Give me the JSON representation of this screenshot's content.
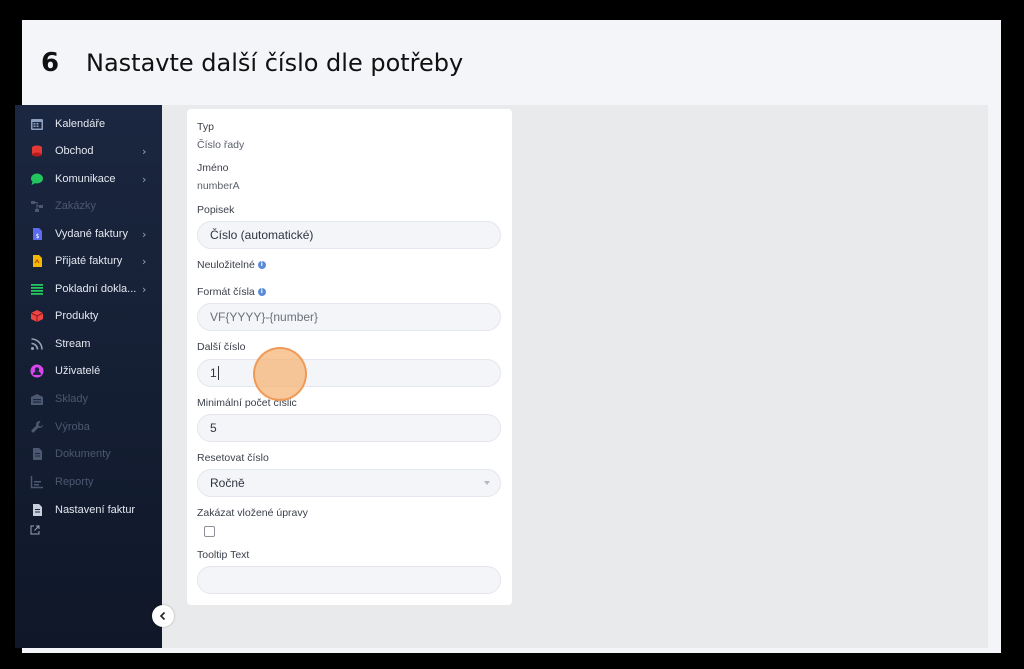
{
  "step": {
    "number": "6",
    "title": "Nastavte další číslo dle potřeby"
  },
  "sidebar": {
    "items": [
      {
        "label": "Kalendáře",
        "icon": "calendar-icon",
        "color": "#8ea0c0",
        "chevron": false,
        "dim": false
      },
      {
        "label": "Obchod",
        "icon": "coins-icon",
        "color": "#e53935",
        "chevron": true,
        "dim": false
      },
      {
        "label": "Komunikace",
        "icon": "chat-icon",
        "color": "#22c55e",
        "chevron": true,
        "dim": false
      },
      {
        "label": "Zakázky",
        "icon": "flow-icon",
        "color": "#4c5770",
        "chevron": false,
        "dim": true
      },
      {
        "label": "Vydané faktury",
        "icon": "invoice-out-icon",
        "color": "#5b6cf0",
        "chevron": true,
        "dim": false
      },
      {
        "label": "Přijaté faktury",
        "icon": "invoice-in-icon",
        "color": "#f5b800",
        "chevron": true,
        "dim": false
      },
      {
        "label": "Pokladní dokla...",
        "icon": "list-icon",
        "color": "#22c55e",
        "chevron": true,
        "dim": false
      },
      {
        "label": "Produkty",
        "icon": "box-icon",
        "color": "#ef4444",
        "chevron": false,
        "dim": false
      },
      {
        "label": "Stream",
        "icon": "rss-icon",
        "color": "#9aa3b5",
        "chevron": false,
        "dim": false
      },
      {
        "label": "Uživatelé",
        "icon": "user-icon",
        "color": "#d946ef",
        "chevron": false,
        "dim": false
      },
      {
        "label": "Sklady",
        "icon": "warehouse-icon",
        "color": "#4c5770",
        "chevron": false,
        "dim": true
      },
      {
        "label": "Výroba",
        "icon": "wrench-icon",
        "color": "#4c5770",
        "chevron": false,
        "dim": true
      },
      {
        "label": "Dokumenty",
        "icon": "document-icon",
        "color": "#4c5770",
        "chevron": false,
        "dim": true
      },
      {
        "label": "Reporty",
        "icon": "report-icon",
        "color": "#4c5770",
        "chevron": false,
        "dim": true
      },
      {
        "label": "Nastavení faktur",
        "icon": "settings-doc-icon",
        "color": "#c9d0dd",
        "chevron": false,
        "dim": false
      }
    ]
  },
  "form": {
    "typ_label": "Typ",
    "typ_value": "Číslo řady",
    "jmeno_label": "Jméno",
    "jmeno_value": "numberA",
    "popisek_label": "Popisek",
    "popisek_value": "Číslo (automatické)",
    "neulozitelne_label": "Neuložitelné",
    "format_label": "Formát čísla",
    "format_value": "VF{YYYY}-{number}",
    "dalsi_label": "Další číslo",
    "dalsi_value": "1",
    "min_label": "Minimální počet číslic",
    "min_value": "5",
    "reset_label": "Resetovat číslo",
    "reset_value": "Ročně",
    "zakazat_label": "Zakázat vložené úpravy",
    "zakazat_checked": false,
    "tooltip_label": "Tooltip Text",
    "tooltip_value": ""
  },
  "colors": {
    "accent_cursor": "#f6b478",
    "info": "#5b8bd6",
    "sidebar_bg": "#1b2740"
  }
}
